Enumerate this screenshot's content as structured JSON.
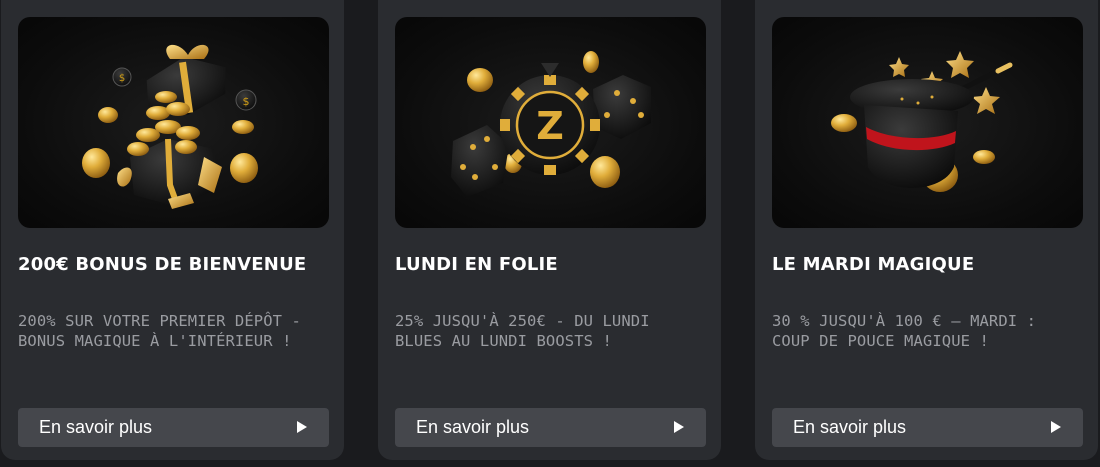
{
  "promotions": [
    {
      "title": "200€ BONUS DE BIENVENUE",
      "description": "200% SUR VOTRE PREMIER DÉPÔT - BONUS MAGIQUE À L'INTÉRIEUR !",
      "button_label": "En savoir plus",
      "image_icon": "gift-box-coins-icon"
    },
    {
      "title": "LUNDI EN FOLIE",
      "description": "25% JUSQU'À 250€ - DU LUNDI BLUES AU LUNDI BOOSTS !",
      "button_label": "En savoir plus",
      "image_icon": "casino-chip-dice-icon"
    },
    {
      "title": "LE MARDI MAGIQUE",
      "description": "30 % JUSQU'À 100 € – MARDI : COUP DE POUCE MAGIQUE !",
      "button_label": "En savoir plus",
      "image_icon": "magic-hat-wand-icon"
    }
  ],
  "colors": {
    "page_background": "#1a1b1e",
    "card_background": "#2a2c30",
    "button_background": "#45474c",
    "title_text": "#ffffff",
    "description_text": "#9a9ca1",
    "gold_accent": "#d4a017"
  }
}
